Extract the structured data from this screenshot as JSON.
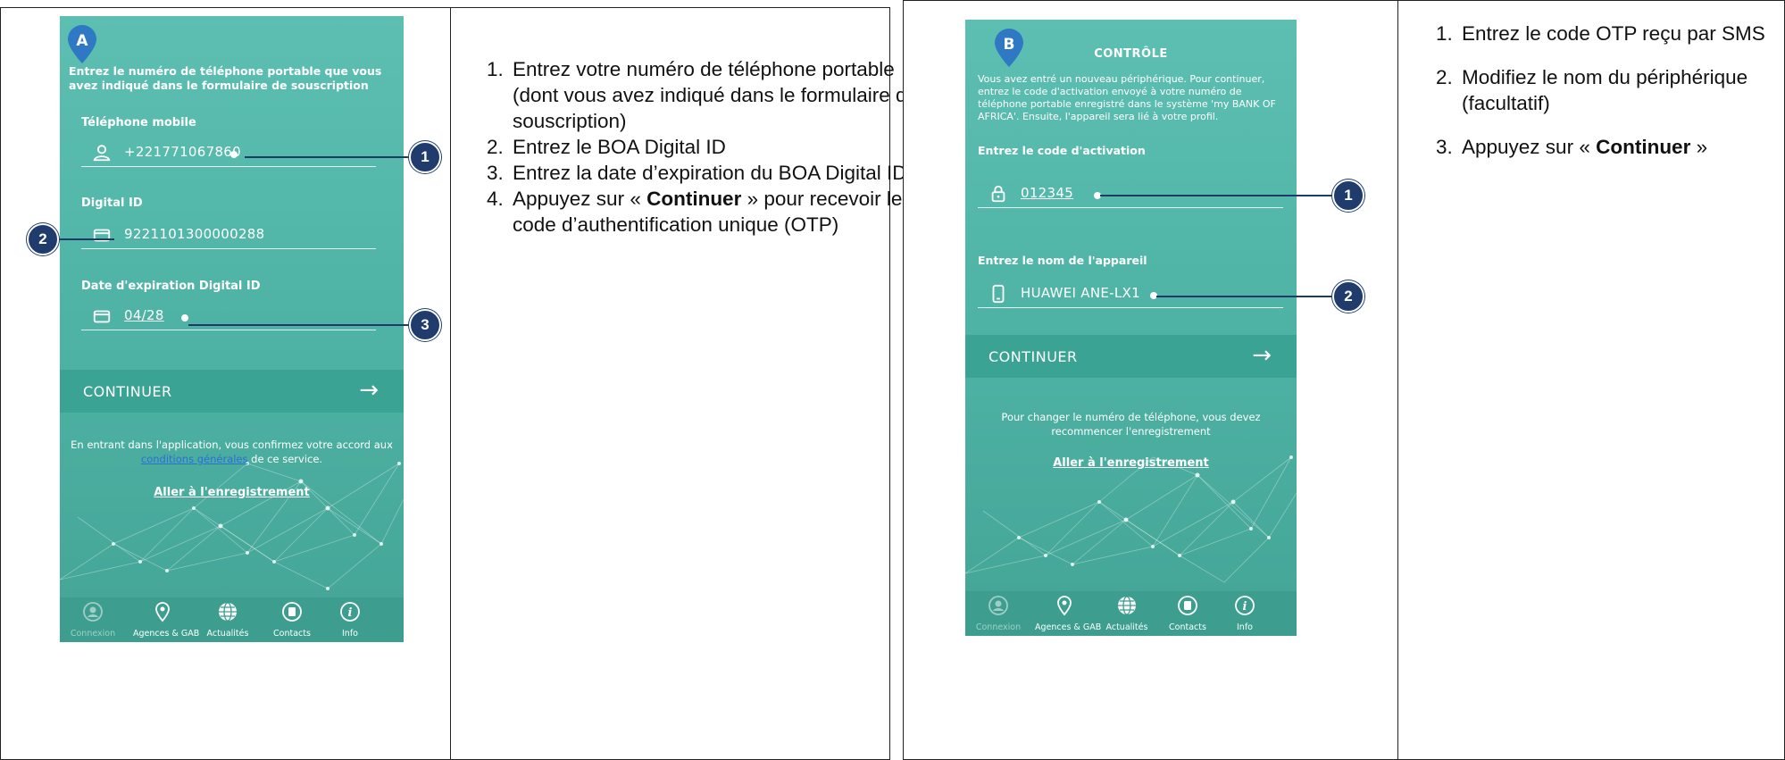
{
  "left": {
    "phone": {
      "marker": "A",
      "faint_header": "",
      "intro": "Entrez le numéro de téléphone portable que vous avez indiqué dans le formulaire de souscription",
      "phone_label": "Téléphone mobile",
      "phone_value": "+221771067860",
      "digital_id_label": "Digital ID",
      "digital_id_value": "9221101300000288",
      "expiry_label": "Date d'expiration Digital ID",
      "expiry_value": "04/28",
      "continue_label": "CONTINUER",
      "terms_before": "En entrant dans l'application, vous confirmez votre accord aux",
      "terms_link": "conditions générales",
      "terms_after": "de ce service.",
      "register_link": "Aller à l'enregistrement"
    },
    "callouts": [
      "1",
      "2",
      "3"
    ],
    "steps": {
      "s1": "Entrez votre numéro de téléphone portable (dont vous avez indiqué dans le formulaire de souscription)",
      "s2": "Entrez le BOA Digital ID",
      "s3": "Entrez la date d’expiration du BOA Digital ID",
      "s4_before": "Appuyez sur « ",
      "s4_bold": "Continuer",
      "s4_after": " » pour recevoir le code d’authentification unique (OTP)"
    }
  },
  "right": {
    "phone": {
      "marker": "B",
      "title": "CONTRÔLE",
      "intro": "Vous avez entré un nouveau périphérique. Pour continuer, entrez le code d'activation envoyé à votre numéro de téléphone portable enregistré dans le système 'my BANK OF AFRICA'. Ensuite, l'appareil sera lié à votre profil.",
      "code_label": "Entrez le code d'activation",
      "code_value": "012345",
      "resend_faint": "",
      "device_label": "Entrez le nom de l'appareil",
      "device_value": "HUAWEI ANE-LX1",
      "continue_label": "CONTINUER",
      "change_note": "Pour changer le numéro de téléphone, vous devez recommencer l'enregistrement",
      "register_link": "Aller à l'enregistrement"
    },
    "callouts": [
      "1",
      "2"
    ],
    "steps": {
      "s1": "Entrez le code OTP reçu par SMS",
      "s2": "Modifiez le nom du périphérique (facultatif)",
      "s3_before": "Appuyez sur « ",
      "s3_bold": "Continuer",
      "s3_after": " »"
    }
  },
  "tabs": [
    "Connexion",
    "Agences & GAB",
    "Actualités",
    "Contacts",
    "Info"
  ],
  "colors": {
    "teal": "#4fb4a6",
    "navy": "#1f3c6c",
    "link_blue": "#2a6fd6"
  }
}
